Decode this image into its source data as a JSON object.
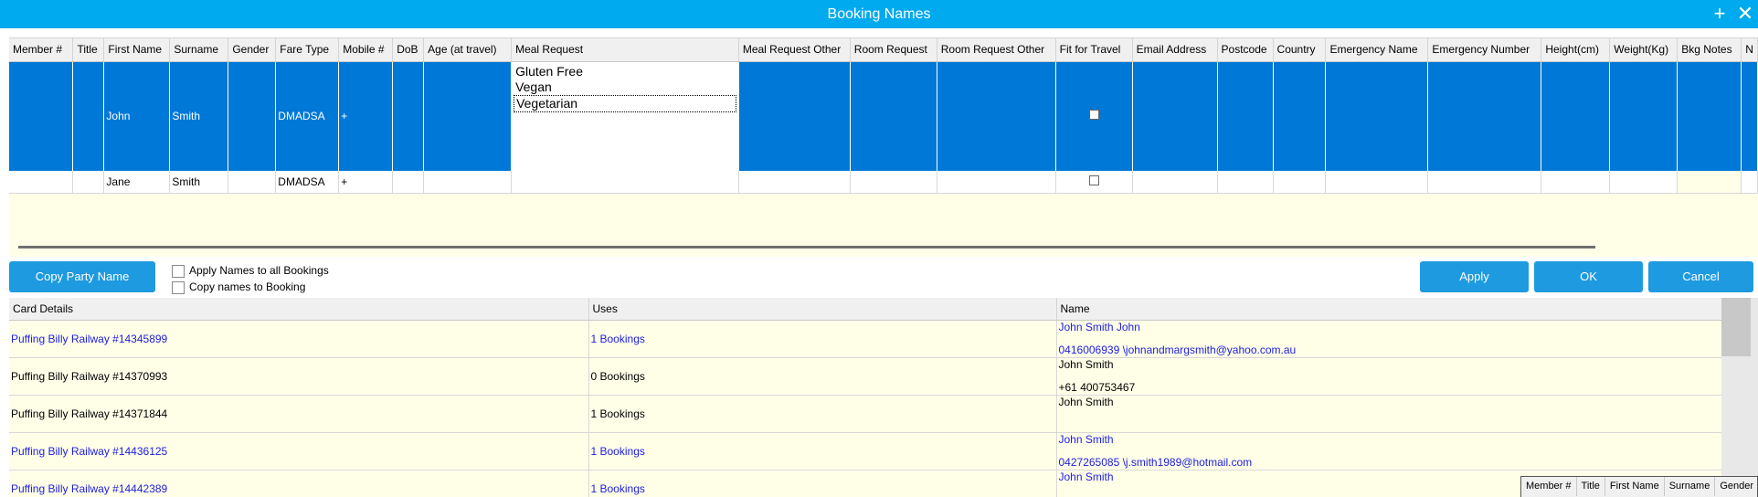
{
  "window": {
    "title": "Booking Names",
    "add_icon": "plus-icon",
    "close_icon": "close-icon"
  },
  "names_grid": {
    "columns": [
      "Member #",
      "Title",
      "First Name",
      "Surname",
      "Gender",
      "Fare Type",
      "Mobile #",
      "DoB",
      "Age (at travel)",
      "Meal Request",
      "Meal Request Other",
      "Room Request",
      "Room Request Other",
      "Fit for Travel",
      "Email Address",
      "Postcode",
      "Country",
      "Emergency Name",
      "Emergency Number",
      "Height(cm)",
      "Weight(Kg)",
      "Bkg Notes",
      "N"
    ],
    "rows": [
      {
        "member": "",
        "title": "",
        "first_name": "John",
        "surname": "Smith",
        "gender": "",
        "fare_type": "DMADSA",
        "mobile": "+",
        "fit_for_travel": false
      },
      {
        "member": "",
        "title": "",
        "first_name": "Jane",
        "surname": "Smith",
        "gender": "",
        "fare_type": "DMADSA",
        "mobile": "+",
        "fit_for_travel": false
      }
    ],
    "meal_options": [
      "Gluten Free",
      "Vegan",
      "Vegetarian"
    ],
    "meal_focused": "Vegetarian",
    "selected_row": 0
  },
  "actions": {
    "copy_party_name": "Copy Party Name",
    "apply_all_label": "Apply Names to all Bookings",
    "copy_to_booking_label": "Copy names to Booking",
    "apply": "Apply",
    "ok": "OK",
    "cancel": "Cancel"
  },
  "cards_grid": {
    "columns": [
      "Card Details",
      "Uses",
      "Name"
    ],
    "rows": [
      {
        "card": "Puffing Billy Railway #14345899",
        "uses": "1 Bookings",
        "name": "John Smith John",
        "contact": "0416006939 \\johnandmargsmith@yahoo.com.au",
        "link": true
      },
      {
        "card": "Puffing Billy Railway #14370993",
        "uses": "0 Bookings",
        "name": "John Smith",
        "contact": "+61  400753467",
        "link": false
      },
      {
        "card": "Puffing Billy Railway #14371844",
        "uses": "1 Bookings",
        "name": "John Smith",
        "contact": "",
        "link": false
      },
      {
        "card": "Puffing Billy Railway #14436125",
        "uses": "1 Bookings",
        "name": "John Smith",
        "contact": "0427265085 \\j.smith1989@hotmail.com",
        "link": true
      },
      {
        "card": "Puffing Billy Railway #14442389",
        "uses": "1 Bookings",
        "name": "John Smith",
        "contact": "",
        "link": true
      }
    ]
  },
  "popup_header": {
    "columns": [
      "Member #",
      "Title",
      "First Name",
      "Surname",
      "Gender"
    ]
  },
  "colors": {
    "titlebar": "#00aaee",
    "selection": "#0078d7",
    "button": "#1e9ae0",
    "row_bg": "#ffffe8",
    "link": "#2020e0"
  }
}
